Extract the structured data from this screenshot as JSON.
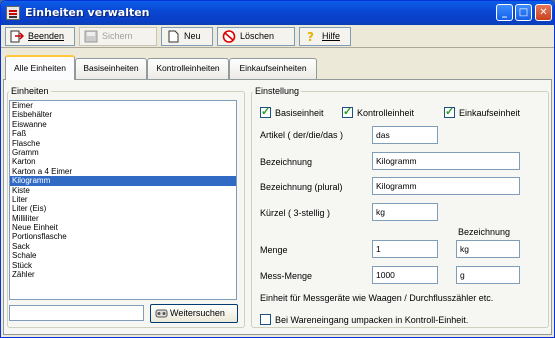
{
  "window": {
    "title": "Einheiten verwalten"
  },
  "toolbar": {
    "beenden": "Beenden",
    "sichern": "Sichern",
    "neu": "Neu",
    "loeschen": "Löschen",
    "hilfe": "Hilfe"
  },
  "tabs": [
    "Alle Einheiten",
    "Basiseinheiten",
    "Kontrolleinheiten",
    "Einkaufseinheiten"
  ],
  "units": {
    "legend": "Einheiten",
    "items": [
      "Eimer",
      "Eisbehälter",
      "Eiswanne",
      "Faß",
      "Flasche",
      "Gramm",
      "Karton",
      "Karton a 4 Eimer",
      "Kilogramm",
      "Kiste",
      "Liter",
      "Liter (Eis)",
      "Milliliter",
      "Neue Einheit",
      "Portionsflasche",
      "Sack",
      "Schale",
      "Stück",
      "Zähler"
    ],
    "selected_index": 8,
    "search_value": "",
    "search_button": "Weitersuchen"
  },
  "settings": {
    "legend": "Einstellung",
    "basis_label": "Basiseinheit",
    "basis_checked": true,
    "kontroll_label": "Kontrolleinheit",
    "kontroll_checked": true,
    "einkauf_label": "Einkaufseinheit",
    "einkauf_checked": true,
    "artikel_label": "Artikel ( der/die/das )",
    "artikel_value": "das",
    "bezeichnung_label": "Bezeichnung",
    "bezeichnung_value": "Kilogramm",
    "plural_label": "Bezeichnung (plural)",
    "plural_value": "Kilogramm",
    "kuerzel_label": "Kürzel ( 3-stellig )",
    "kuerzel_value": "kg",
    "bezeichnung_col_header": "Bezeichnung",
    "menge_label": "Menge",
    "menge_value": "1",
    "menge_unit": "kg",
    "messmenge_label": "Mess-Menge",
    "messmenge_value": "1000",
    "messmenge_unit": "g",
    "info_text": "Einheit für Messgeräte wie Waagen / Durchflusszähler etc.",
    "umpacken_label": "Bei Wareneingang umpacken in Kontroll-Einheit.",
    "umpacken_checked": false
  }
}
